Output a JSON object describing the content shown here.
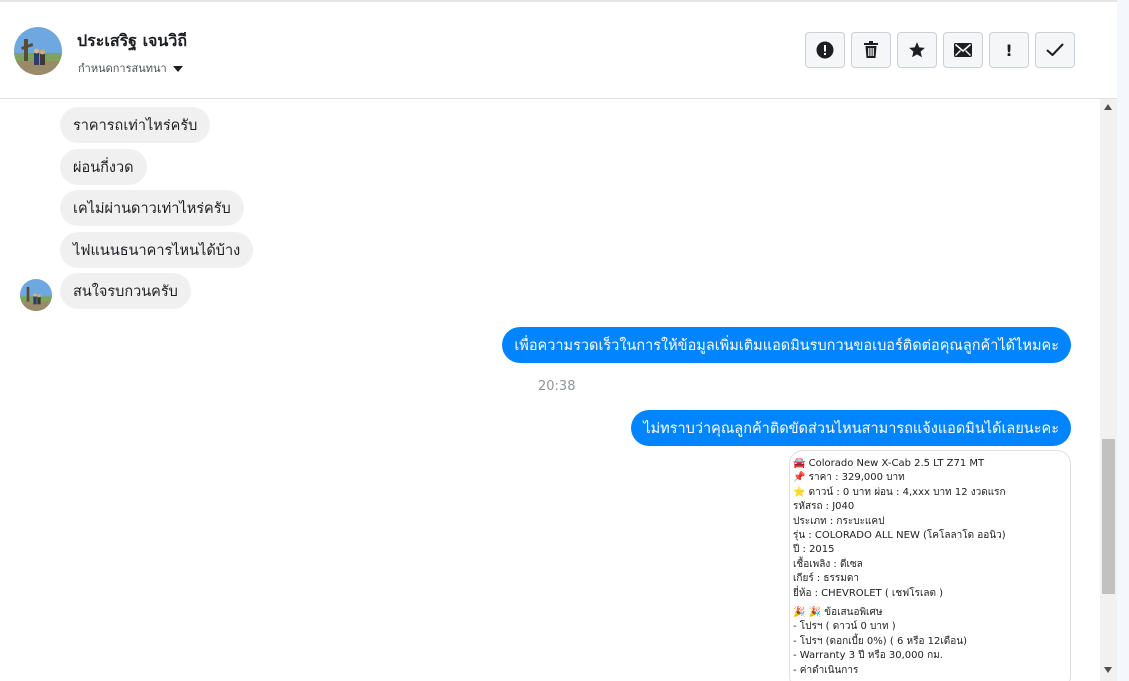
{
  "header": {
    "contact_name": "ประเสริฐ เจนวิถี",
    "conversation_settings": "กำหนดการสนทนา"
  },
  "toolbar": [
    {
      "name": "mark-spam",
      "icon": "alert-circle-icon"
    },
    {
      "name": "delete",
      "icon": "trash-icon"
    },
    {
      "name": "star",
      "icon": "star-icon"
    },
    {
      "name": "mark-unread",
      "icon": "envelope-icon"
    },
    {
      "name": "mark-important",
      "icon": "exclamation-icon",
      "text": "!"
    },
    {
      "name": "mark-done",
      "icon": "check-icon"
    }
  ],
  "messages_incoming": [
    "ราคารถเท่าไหร่ครับ",
    "ผ่อนกี่งวด",
    "เคไม่ผ่านดาวเท่าไหร่ครับ",
    "ไฟแนนธนาคารไหนได้บ้าง",
    "สนใจรบกวนครับ"
  ],
  "messages_outgoing": [
    "เพื่อความรวดเร็วในการให้ข้อมูลเพิ่มเติมแอดมินรบกวนขอเบอร์ติดต่อคุณลูกค้าได้ไหมคะ",
    "ไม่ทราบว่าคุณลูกค้าติดขัดส่วนไหนสามารถแจ้งแอดมินได้เลยนะคะ"
  ],
  "timestamp": "20:38",
  "card": {
    "lines": [
      "🚘 Colorado New X-Cab 2.5 LT Z71 MT",
      "📌 ราคา : 329,000 บาท",
      "⭐ ดาวน์ : 0 บาท ผ่อน : 4,xxx บาท 12 งวดแรก",
      "   รหัสรถ : J040",
      "   ประเภท : กระบะแคป",
      "   รุ่น : COLORADO ALL NEW (โคโลลาโด ออนิว)",
      "   ปี : 2015",
      "   เชื้อเพลิง : ดีเซล",
      "   เกียร์ : ธรรมดา",
      "   ยี่ห้อ : CHEVROLET ( เชฟโรเลต )",
      "",
      "🎉 🎉 ข้อเสนอพิเศษ",
      " - โปรฯ ( ดาวน์ 0 บาท )",
      " - โปรฯ (ดอกเบี้ย 0%) ( 6 หรือ 12เดือน)",
      " - Warranty 3 ปี หรือ 30,000 กม.",
      " - ค่าดำเนินการ"
    ]
  },
  "colors": {
    "outgoing_bubble": "#0084ff",
    "incoming_bubble": "#f1f0f0"
  }
}
